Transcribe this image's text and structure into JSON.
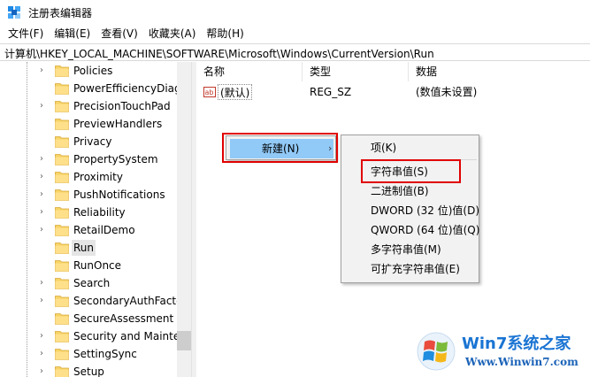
{
  "window": {
    "title": "注册表编辑器"
  },
  "menu": [
    "文件(F)",
    "编辑(E)",
    "查看(V)",
    "收藏夹(A)",
    "帮助(H)"
  ],
  "address": "计算机\\HKEY_LOCAL_MACHINE\\SOFTWARE\\Microsoft\\Windows\\CurrentVersion\\Run",
  "tree": {
    "items": [
      {
        "label": "Policies",
        "expander": "›",
        "selected": false
      },
      {
        "label": "PowerEfficiencyDiag",
        "expander": "",
        "selected": false
      },
      {
        "label": "PrecisionTouchPad",
        "expander": "›",
        "selected": false
      },
      {
        "label": "PreviewHandlers",
        "expander": "",
        "selected": false
      },
      {
        "label": "Privacy",
        "expander": "",
        "selected": false
      },
      {
        "label": "PropertySystem",
        "expander": "›",
        "selected": false
      },
      {
        "label": "Proximity",
        "expander": "›",
        "selected": false
      },
      {
        "label": "PushNotifications",
        "expander": "›",
        "selected": false
      },
      {
        "label": "Reliability",
        "expander": "›",
        "selected": false
      },
      {
        "label": "RetailDemo",
        "expander": "›",
        "selected": false
      },
      {
        "label": "Run",
        "expander": "",
        "selected": true
      },
      {
        "label": "RunOnce",
        "expander": "",
        "selected": false
      },
      {
        "label": "Search",
        "expander": "›",
        "selected": false
      },
      {
        "label": "SecondaryAuthFactc",
        "expander": "›",
        "selected": false
      },
      {
        "label": "SecureAssessment",
        "expander": "",
        "selected": false
      },
      {
        "label": "Security and Mainte",
        "expander": "›",
        "selected": false
      },
      {
        "label": "SettingSync",
        "expander": "›",
        "selected": false
      },
      {
        "label": "Setup",
        "expander": "›",
        "selected": false
      }
    ]
  },
  "list": {
    "columns": [
      "名称",
      "类型",
      "数据"
    ],
    "rows": [
      {
        "name": "(默认)",
        "type": "REG_SZ",
        "data": "(数值未设置)",
        "icon": "string-value-icon"
      }
    ]
  },
  "context_menu": {
    "new_label": "新建(N)",
    "arrow": "›",
    "submenu": [
      "项(K)",
      "字符串值(S)",
      "二进制值(B)",
      "DWORD (32 位)值(D)",
      "QWORD (64 位)值(Q)",
      "多字符串值(M)",
      "可扩充字符串值(E)"
    ]
  },
  "watermark": {
    "title": "Win7系统之家",
    "url": "Www.Winwin7.com"
  },
  "colors": {
    "highlight": "#91c9f7",
    "annotation": "#e00000",
    "folder": "#f6d365",
    "brand": "#1a74d3"
  }
}
